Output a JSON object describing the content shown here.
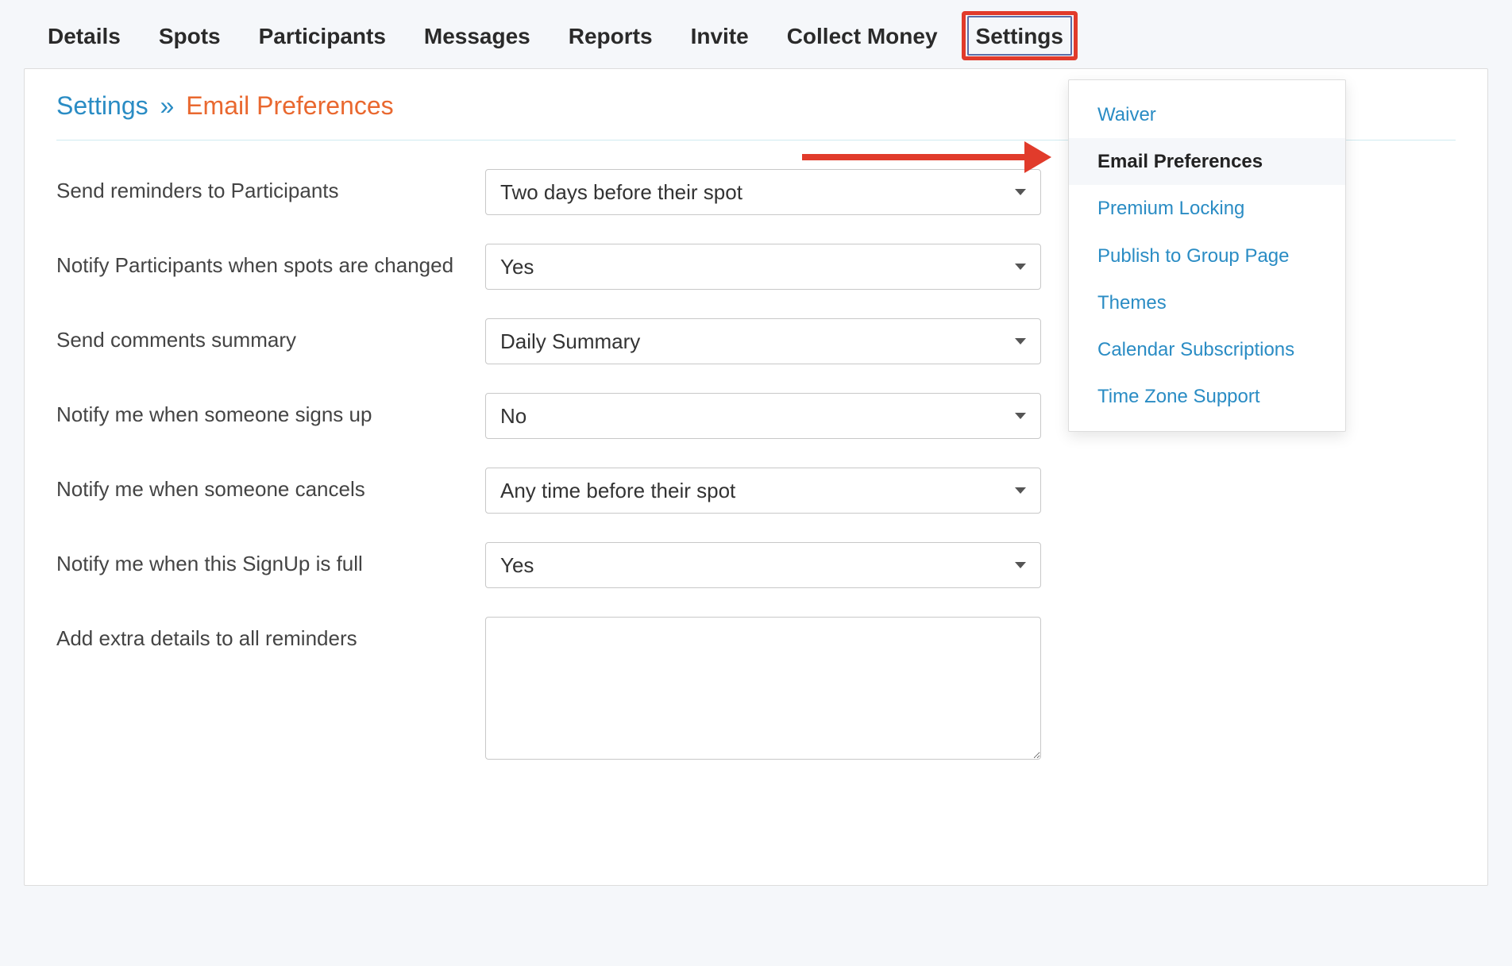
{
  "tabs": {
    "details": "Details",
    "spots": "Spots",
    "participants": "Participants",
    "messages": "Messages",
    "reports": "Reports",
    "invite": "Invite",
    "collect_money": "Collect Money",
    "settings": "Settings"
  },
  "breadcrumb": {
    "root": "Settings",
    "sep": "»",
    "leaf": "Email Preferences"
  },
  "form": {
    "reminders": {
      "label": "Send reminders to Participants",
      "value": "Two days before their spot"
    },
    "notify_changes": {
      "label": "Notify Participants when spots are changed",
      "value": "Yes"
    },
    "comments_summary": {
      "label": "Send comments summary",
      "value": "Daily Summary"
    },
    "notify_signup": {
      "label": "Notify me when someone signs up",
      "value": "No"
    },
    "notify_cancel": {
      "label": "Notify me when someone cancels",
      "value": "Any time before their spot"
    },
    "notify_full": {
      "label": "Notify me when this SignUp is full",
      "value": "Yes"
    },
    "extra_details": {
      "label": "Add extra details to all reminders",
      "value": ""
    }
  },
  "settings_menu": {
    "waiver": "Waiver",
    "email_preferences": "Email Preferences",
    "premium_locking": "Premium Locking",
    "publish_group": "Publish to Group Page",
    "themes": "Themes",
    "calendar_subs": "Calendar Subscriptions",
    "timezone": "Time Zone Support"
  }
}
